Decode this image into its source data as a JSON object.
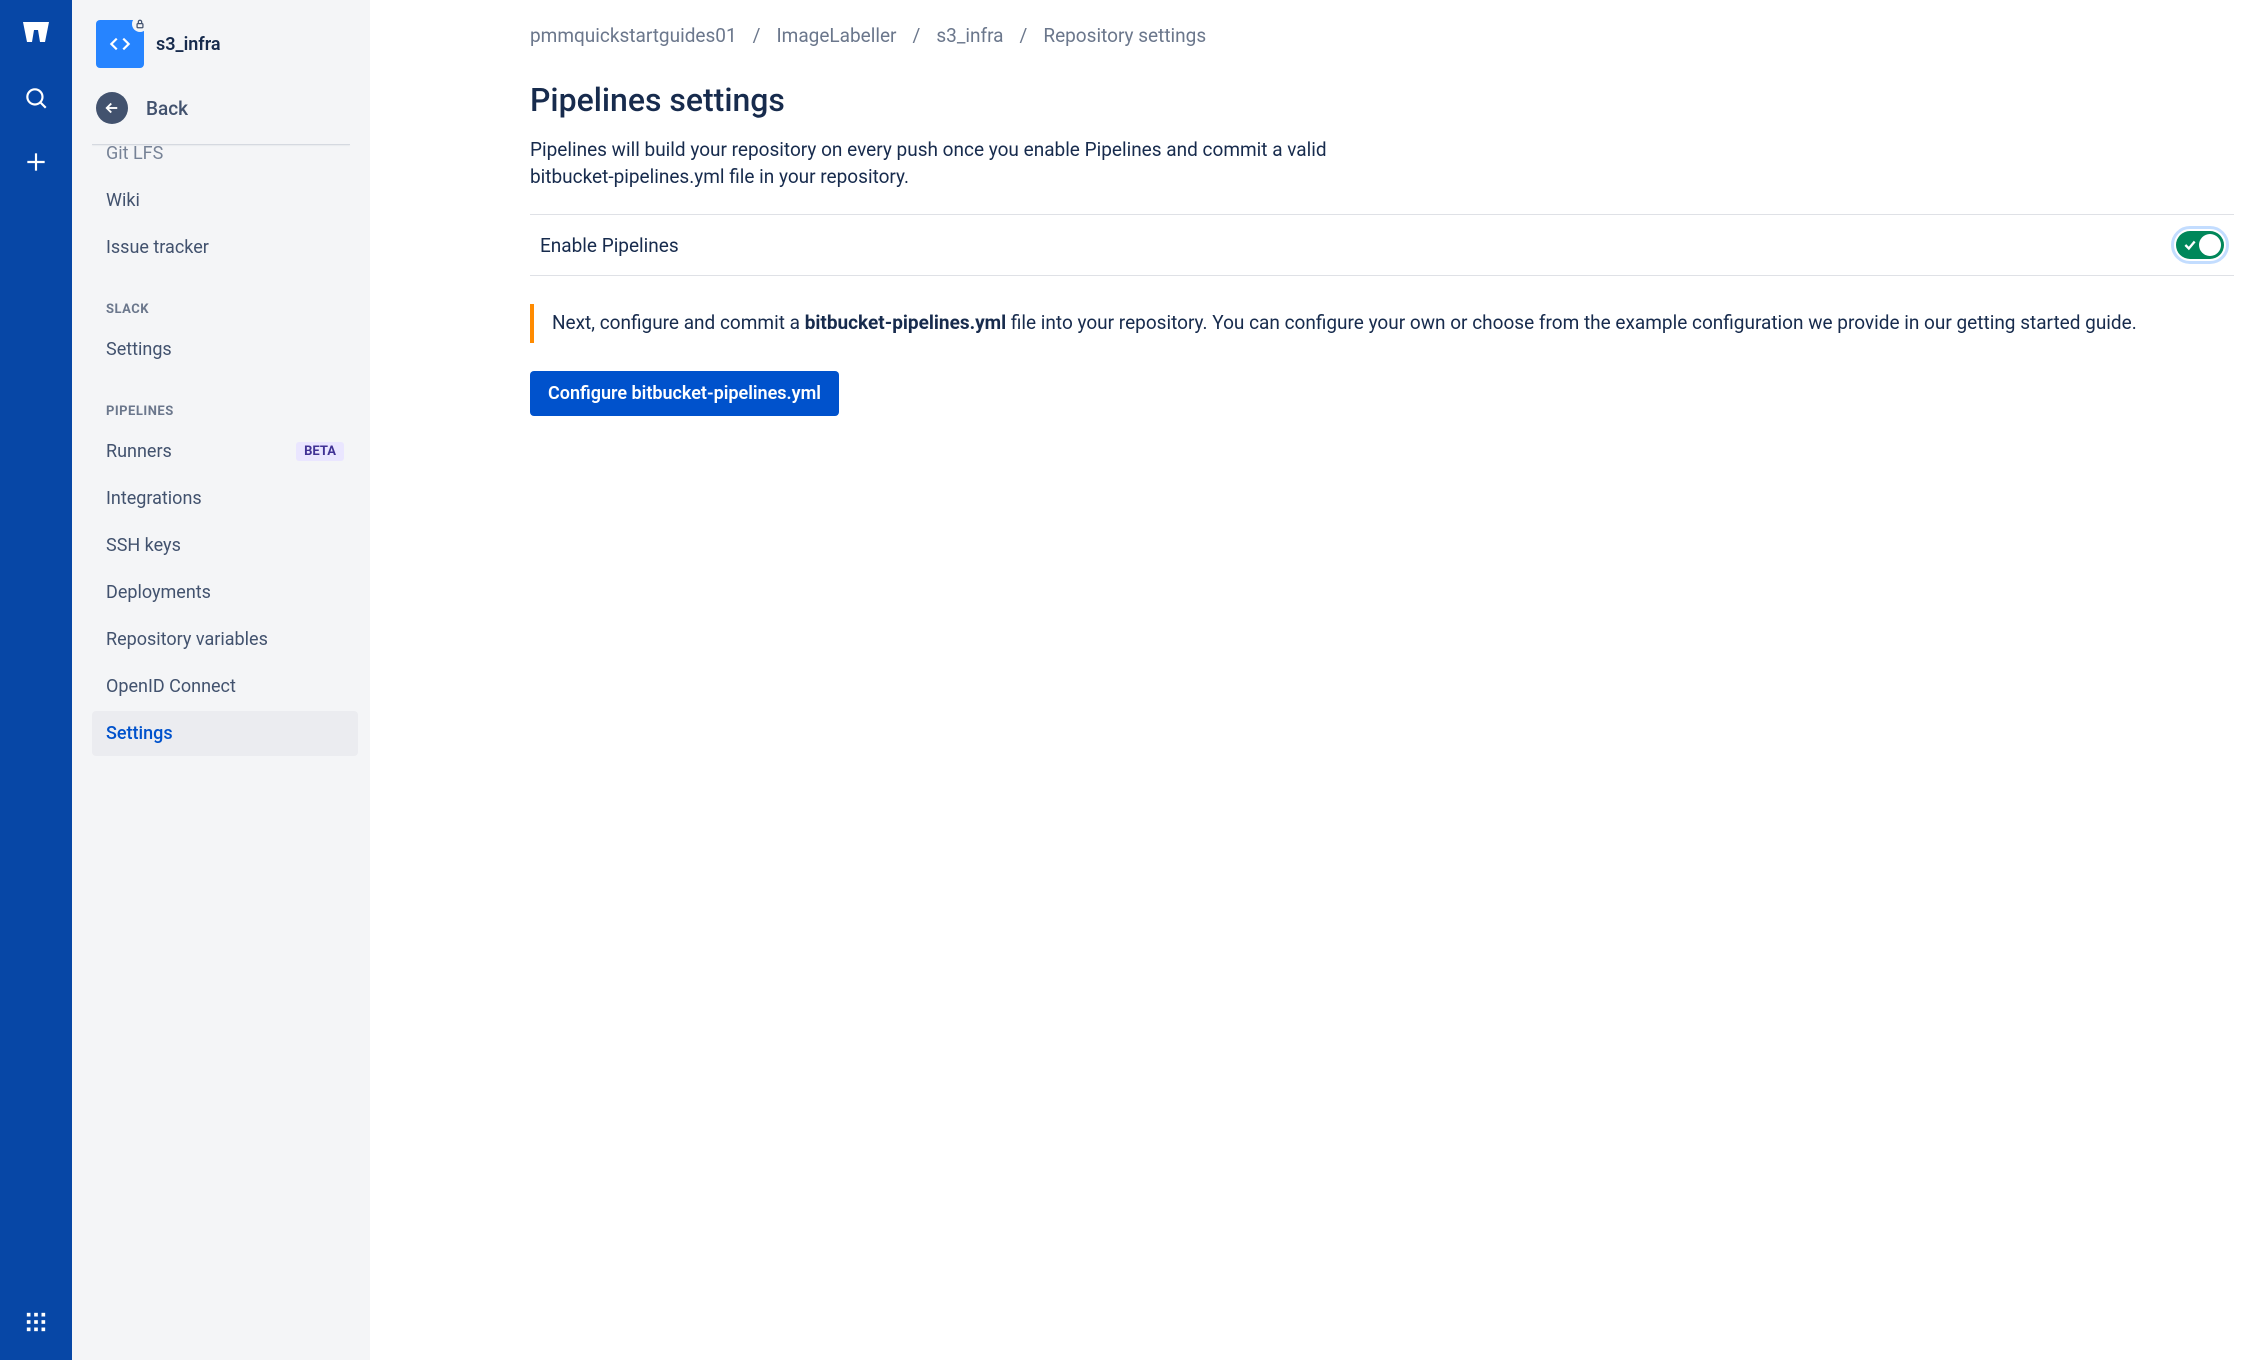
{
  "repo": {
    "name": "s3_infra"
  },
  "back_label": "Back",
  "sidebar": {
    "top_items": [
      {
        "label": "Git LFS",
        "partial": true
      },
      {
        "label": "Wiki"
      },
      {
        "label": "Issue tracker"
      }
    ],
    "section_slack": "SLACK",
    "slack_items": [
      {
        "label": "Settings"
      }
    ],
    "section_pipelines": "PIPELINES",
    "pipelines_items": [
      {
        "label": "Runners",
        "badge": "BETA"
      },
      {
        "label": "Integrations"
      },
      {
        "label": "SSH keys"
      },
      {
        "label": "Deployments"
      },
      {
        "label": "Repository variables"
      },
      {
        "label": "OpenID Connect"
      },
      {
        "label": "Settings",
        "selected": true
      }
    ]
  },
  "breadcrumb": [
    "pmmquickstartguides01",
    "ImageLabeller",
    "s3_infra",
    "Repository settings"
  ],
  "main": {
    "title": "Pipelines settings",
    "desc": "Pipelines will build your repository on every push once you enable Pipelines and commit a valid bitbucket-pipelines.yml file in your repository.",
    "toggle_label": "Enable Pipelines",
    "callout_prefix": "Next, configure and commit a ",
    "callout_bold": "bitbucket-pipelines.yml",
    "callout_suffix": " file into your repository. You can configure your own or choose from the example configuration we provide in our getting started guide.",
    "button": "Configure bitbucket-pipelines.yml"
  }
}
